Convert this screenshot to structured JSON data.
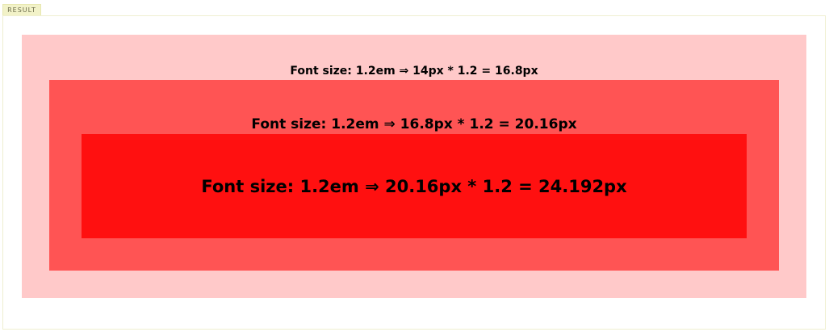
{
  "result_tab": {
    "label": "RESULT"
  },
  "boxes": {
    "outer": {
      "text": "Font size: 1.2em ⇒ 14px * 1.2 = 16.8px",
      "color": "#ffc9c9"
    },
    "middle": {
      "text": "Font size: 1.2em ⇒ 16.8px * 1.2 = 20.16px",
      "color": "#ff5454"
    },
    "inner": {
      "text": "Font size: 1.2em ⇒ 20.16px * 1.2 = 24.192px",
      "color": "#ff1010"
    }
  }
}
